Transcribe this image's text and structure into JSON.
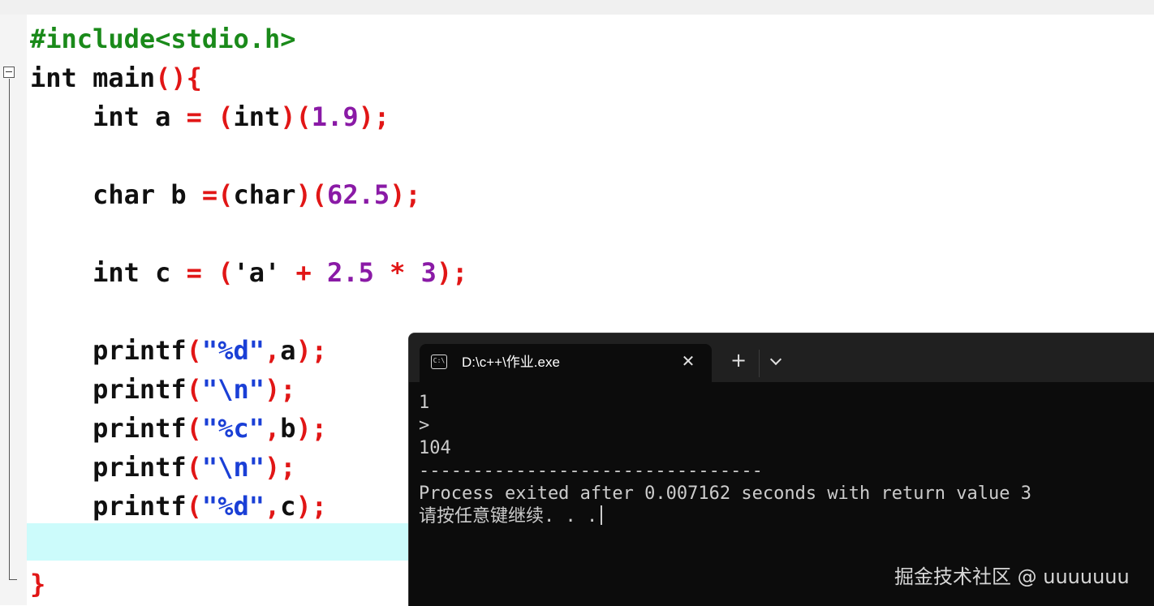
{
  "editor": {
    "lines": [
      [
        {
          "t": "#include<stdio.h>",
          "c": "pp"
        }
      ],
      [
        {
          "t": "int main",
          "c": "kw"
        },
        {
          "t": "(){",
          "c": "pn"
        }
      ],
      [
        {
          "t": "    int a ",
          "c": "kw"
        },
        {
          "t": "=",
          "c": "op"
        },
        {
          "t": " (",
          "c": "pn"
        },
        {
          "t": "int",
          "c": "kw"
        },
        {
          "t": ")(",
          "c": "pn"
        },
        {
          "t": "1.9",
          "c": "num"
        },
        {
          "t": ");",
          "c": "pn"
        }
      ],
      [],
      [
        {
          "t": "    char b ",
          "c": "kw"
        },
        {
          "t": "=(",
          "c": "op"
        },
        {
          "t": "char",
          "c": "kw"
        },
        {
          "t": ")(",
          "c": "pn"
        },
        {
          "t": "62.5",
          "c": "num"
        },
        {
          "t": ");",
          "c": "pn"
        }
      ],
      [],
      [
        {
          "t": "    int c ",
          "c": "kw"
        },
        {
          "t": "=",
          "c": "op"
        },
        {
          "t": " (",
          "c": "pn"
        },
        {
          "t": "'a'",
          "c": "kw"
        },
        {
          "t": " + ",
          "c": "op"
        },
        {
          "t": "2.5",
          "c": "num"
        },
        {
          "t": " * ",
          "c": "op"
        },
        {
          "t": "3",
          "c": "num"
        },
        {
          "t": ");",
          "c": "pn"
        }
      ],
      [],
      [
        {
          "t": "    printf",
          "c": "kw"
        },
        {
          "t": "(",
          "c": "pn"
        },
        {
          "t": "\"%d\"",
          "c": "str"
        },
        {
          "t": ",",
          "c": "pn"
        },
        {
          "t": "a",
          "c": "kw"
        },
        {
          "t": ");",
          "c": "pn"
        }
      ],
      [
        {
          "t": "    printf",
          "c": "kw"
        },
        {
          "t": "(",
          "c": "pn"
        },
        {
          "t": "\"\\n\"",
          "c": "str"
        },
        {
          "t": ");",
          "c": "pn"
        }
      ],
      [
        {
          "t": "    printf",
          "c": "kw"
        },
        {
          "t": "(",
          "c": "pn"
        },
        {
          "t": "\"%c\"",
          "c": "str"
        },
        {
          "t": ",",
          "c": "pn"
        },
        {
          "t": "b",
          "c": "kw"
        },
        {
          "t": ");",
          "c": "pn"
        }
      ],
      [
        {
          "t": "    printf",
          "c": "kw"
        },
        {
          "t": "(",
          "c": "pn"
        },
        {
          "t": "\"\\n\"",
          "c": "str"
        },
        {
          "t": ");",
          "c": "pn"
        }
      ],
      [
        {
          "t": "    printf",
          "c": "kw"
        },
        {
          "t": "(",
          "c": "pn"
        },
        {
          "t": "\"%d\"",
          "c": "str"
        },
        {
          "t": ",",
          "c": "pn"
        },
        {
          "t": "c",
          "c": "kw"
        },
        {
          "t": ");",
          "c": "pn"
        }
      ],
      [],
      [
        {
          "t": "}",
          "c": "pn"
        }
      ]
    ]
  },
  "terminal": {
    "tab_title": "D:\\c++\\作业.exe",
    "tab_icon_text": "C:\\",
    "close_glyph": "✕",
    "new_tab_glyph": "+",
    "output": [
      "1",
      ">",
      "104",
      "--------------------------------",
      "Process exited after 0.007162 seconds with return value 3",
      "请按任意键继续. . ."
    ],
    "watermark": "掘金技术社区 @ uuuuuuu"
  }
}
